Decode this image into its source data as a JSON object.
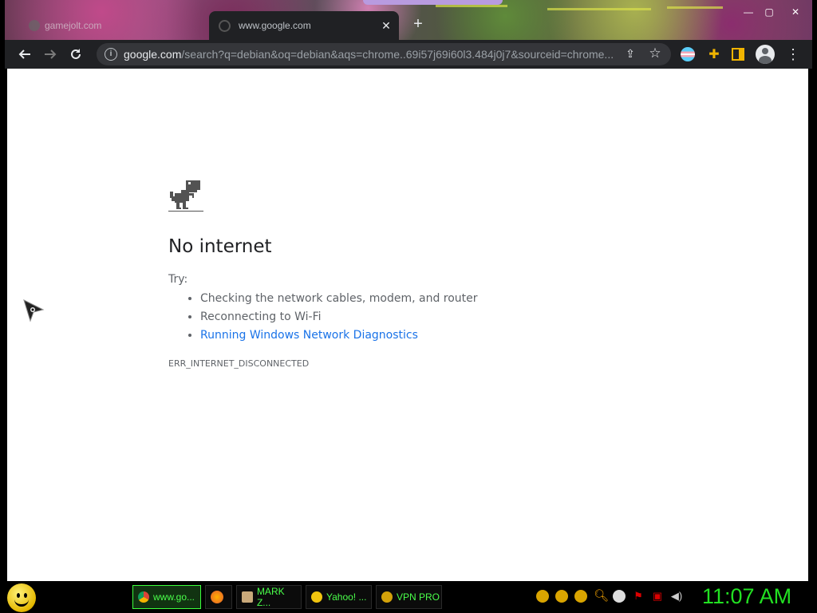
{
  "browser": {
    "tabs": [
      {
        "title": "gamejolt.com",
        "active": false
      },
      {
        "title": "www.google.com",
        "active": true
      }
    ],
    "new_tab_symbol": "+",
    "window_controls": {
      "minimize": "—",
      "maximize": "▢",
      "close": "✕"
    },
    "toolbar": {
      "url_host": "google.com",
      "url_rest": "/search?q=debian&oq=debian&aqs=chrome..69i57j69i60l3.484j0j7&sourceid=chrome..."
    }
  },
  "error_page": {
    "title": "No internet",
    "try_label": "Try:",
    "suggestions": [
      "Checking the network cables, modem, and router",
      "Reconnecting to Wi-Fi"
    ],
    "suggestion_link": "Running Windows Network Diagnostics",
    "error_code": "ERR_INTERNET_DISCONNECTED"
  },
  "taskbar": {
    "tasks": [
      {
        "label": "www.go..."
      },
      {
        "label": ""
      },
      {
        "label": "MARK Z..."
      },
      {
        "label": "Yahoo! ..."
      },
      {
        "label": "VPN PRO"
      }
    ],
    "clock": "11:07 AM"
  },
  "colors": {
    "taskbar_text": "#4aff4a",
    "clock": "#22e022",
    "link": "#1a73e8"
  }
}
